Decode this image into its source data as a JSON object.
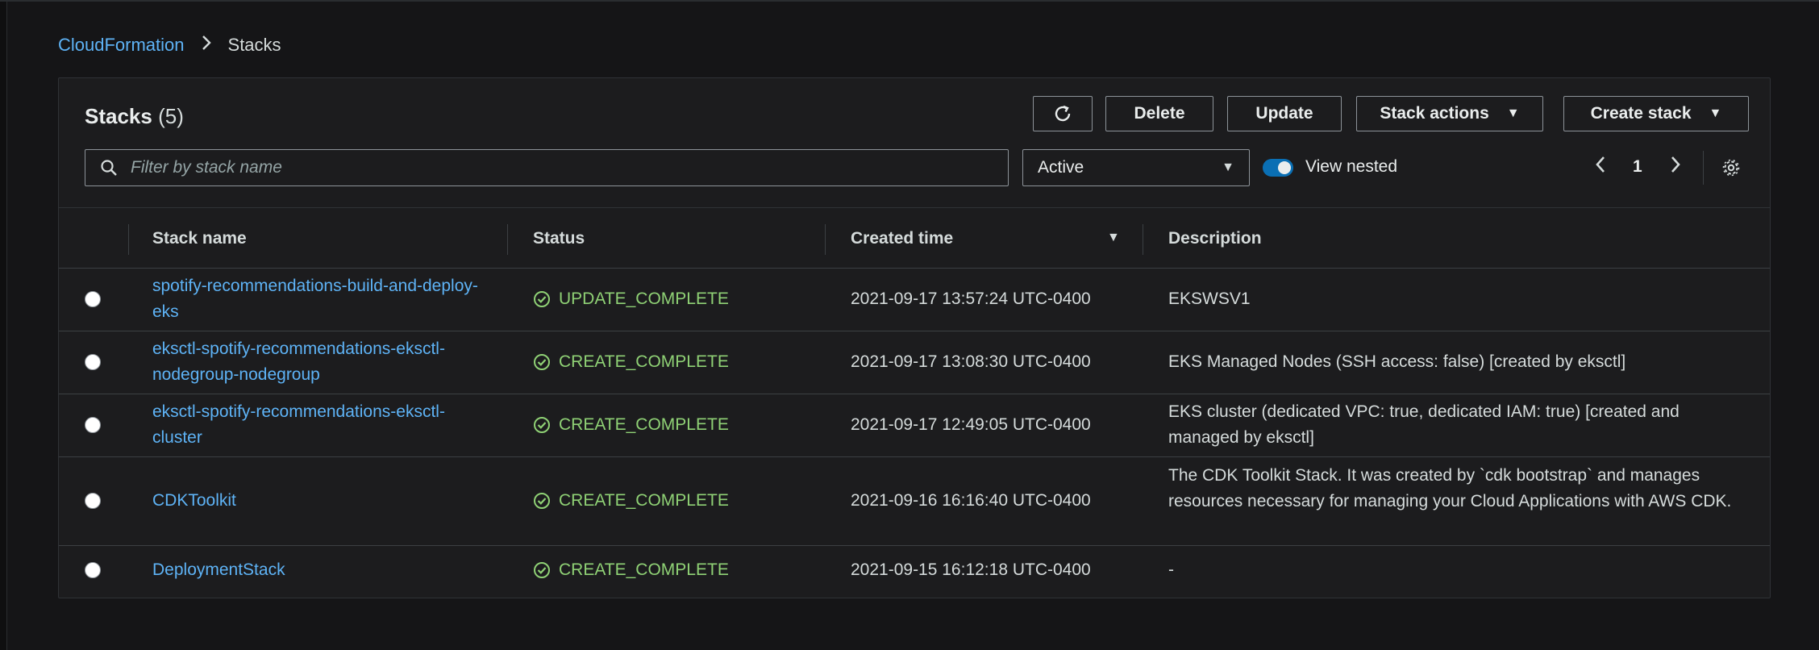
{
  "breadcrumb": {
    "parent": "CloudFormation",
    "current": "Stacks"
  },
  "panel": {
    "title": "Stacks",
    "count": "(5)"
  },
  "toolbar": {
    "delete_label": "Delete",
    "update_label": "Update",
    "actions_label": "Stack actions",
    "create_label": "Create stack"
  },
  "filter": {
    "placeholder": "Filter by stack name",
    "value": ""
  },
  "status_select": {
    "value": "Active"
  },
  "nested_toggle": {
    "label": "View nested",
    "on": true
  },
  "pagination": {
    "page": "1"
  },
  "table": {
    "headers": [
      "Stack name",
      "Status",
      "Created time",
      "Description"
    ],
    "rows": [
      {
        "name": "spotify-recommendations-build-and-deploy-eks",
        "status": "UPDATE_COMPLETE",
        "created": "2021-09-17 13:57:24 UTC-0400",
        "description": "EKSWSV1"
      },
      {
        "name": "eksctl-spotify-recommendations-eksctl-nodegroup-nodegroup",
        "status": "CREATE_COMPLETE",
        "created": "2021-09-17 13:08:30 UTC-0400",
        "description": "EKS Managed Nodes (SSH access: false) [created by eksctl]"
      },
      {
        "name": "eksctl-spotify-recommendations-eksctl-cluster",
        "status": "CREATE_COMPLETE",
        "created": "2021-09-17 12:49:05 UTC-0400",
        "description": "EKS cluster (dedicated VPC: true, dedicated IAM: true) [created and managed by eksctl]"
      },
      {
        "name": "CDKToolkit",
        "status": "CREATE_COMPLETE",
        "created": "2021-09-16 16:16:40 UTC-0400",
        "description": "The CDK Toolkit Stack. It was created by `cdk bootstrap` and manages resources necessary for managing your Cloud Applications with AWS CDK."
      },
      {
        "name": "DeploymentStack",
        "status": "CREATE_COMPLETE",
        "created": "2021-09-15 16:12:18 UTC-0400",
        "description": "-"
      }
    ]
  },
  "colors": {
    "link": "#5eb3f6",
    "success": "#8fd175",
    "toggle_on": "#0a6fb4",
    "background": "#151517"
  }
}
